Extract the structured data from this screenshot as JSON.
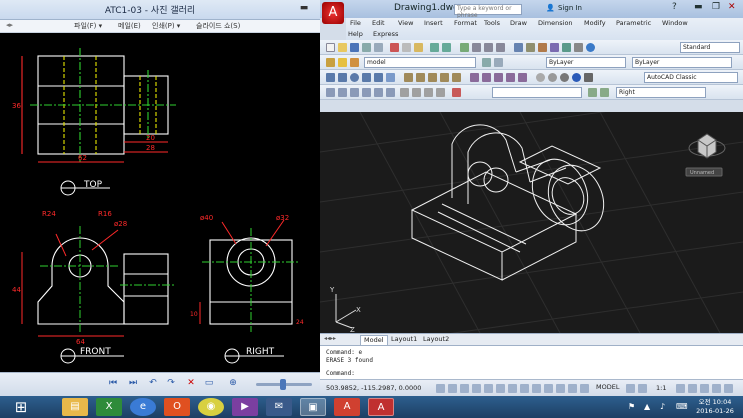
{
  "gallery": {
    "title": "ATC1-03 - 사진 갤러리",
    "menu": [
      "파일(F) ▾",
      "메일(E)",
      "인쇄(P) ▾",
      "슬라이드 쇼(S)"
    ],
    "drawing_labels": {
      "top_view": "TOP",
      "front_view": "FRONT",
      "right_view": "RIGHT",
      "dim_r24": "R24",
      "dim_r16": "R16",
      "dim_d28": "ø28",
      "dim_d40": "ø40",
      "dim_d32": "ø32",
      "dim_62": "62",
      "dim_28": "28",
      "dim_20": "20",
      "dim_64": "64",
      "dim_44": "44",
      "dim_24": "24",
      "dim_10": "10",
      "dim_36": "36"
    }
  },
  "acad": {
    "app_icon": "autocad-logo-icon",
    "doc_title": "Drawing1.dwg",
    "search_placeholder": "Type a keyword or phrase",
    "sign_in": "Sign In",
    "menu": [
      "File",
      "Edit",
      "View",
      "Insert",
      "Format",
      "Tools",
      "Draw",
      "Dimension",
      "Modify",
      "Parametric",
      "Window",
      "Help",
      "Express"
    ],
    "toolbar": {
      "text_style": "Standard",
      "layer": "model",
      "color": "ByLayer",
      "linetype": "ByLayer",
      "workspace": "AutoCAD Classic",
      "view": "Right"
    },
    "viewcube_label": "Unnamed",
    "tabs": [
      "Model",
      "Layout1",
      "Layout2"
    ],
    "command_history": [
      "Command: e",
      "ERASE 3 found"
    ],
    "command_prompt": "Command:",
    "coords": "503.9852, -115.2987, 0.0000",
    "model_label": "MODEL",
    "scale": "1:1"
  },
  "taskbar": {
    "clock_time": "오전 10:04",
    "clock_date": "2016-01-26"
  },
  "colors": {
    "drawing_white": "#ffffff",
    "dim_red": "#ff2a2a",
    "center_green": "#2fd12f",
    "hidden_yellow": "#e6e600",
    "acad_bg": "#1b1b1b",
    "taskbar": "#1d3f64"
  }
}
